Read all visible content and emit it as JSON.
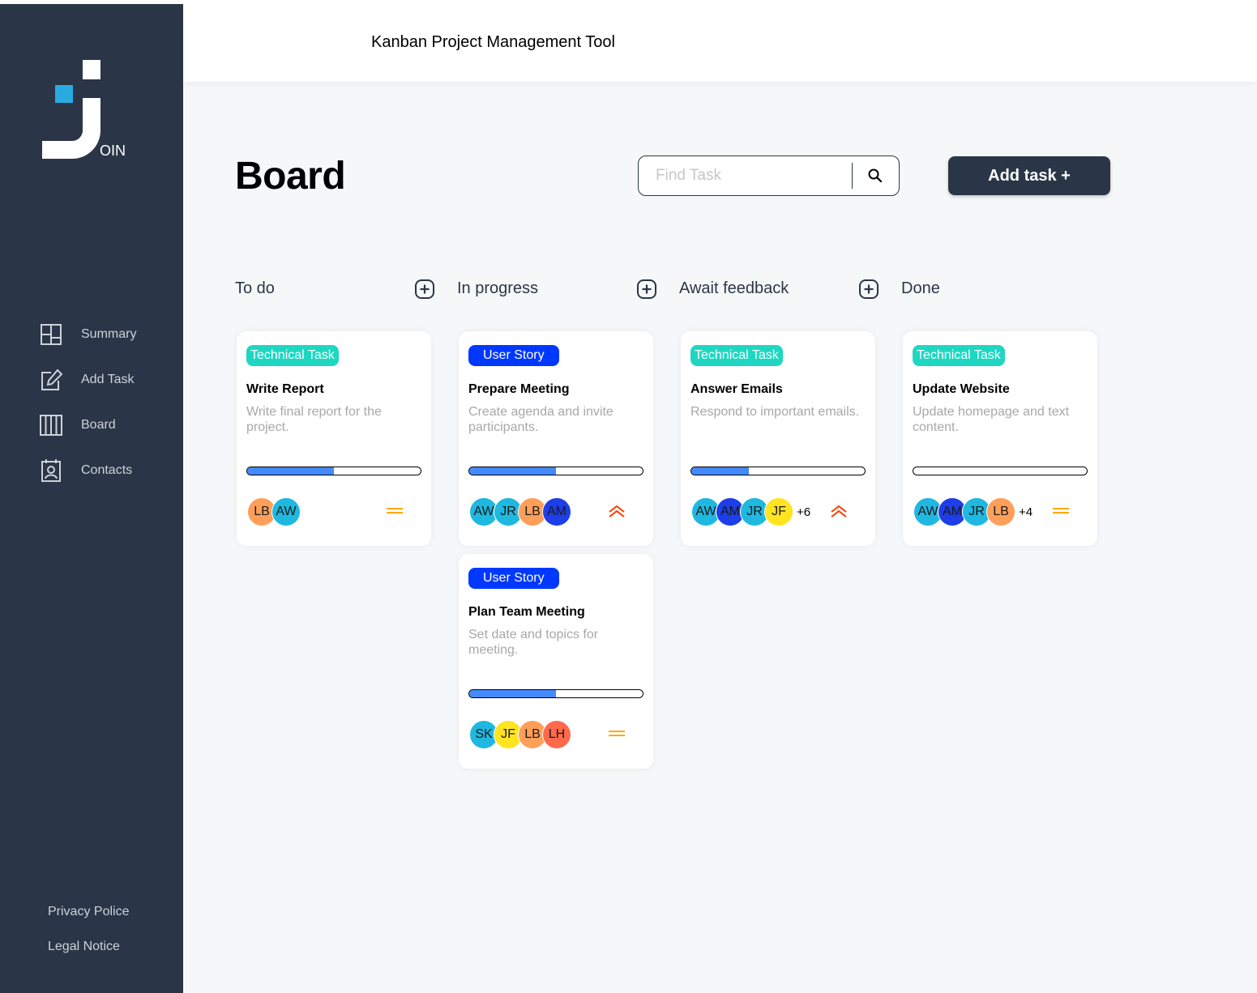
{
  "app": {
    "title": "Kanban Project Management Tool",
    "logo_text": "OIN"
  },
  "sidebar": {
    "items": [
      {
        "label": "Summary",
        "icon": "summary-icon"
      },
      {
        "label": "Add Task",
        "icon": "add-task-icon"
      },
      {
        "label": "Board",
        "icon": "board-icon"
      },
      {
        "label": "Contacts",
        "icon": "contacts-icon"
      }
    ],
    "footer": {
      "privacy": "Privacy Police",
      "legal": "Legal Notice"
    }
  },
  "board": {
    "title": "Board",
    "search_placeholder": "Find Task",
    "add_task_label": "Add task +"
  },
  "colors": {
    "sidebar": "#2a3647",
    "technical_task": "#1fd7c1",
    "user_story": "#0038ff",
    "progress": "#4589ff",
    "priority_urgent": "#ff3d00",
    "priority_medium": "#ffa800"
  },
  "columns": [
    {
      "title": "To do"
    },
    {
      "title": "In progress"
    },
    {
      "title": "Await feedback"
    },
    {
      "title": "Done"
    }
  ],
  "cards": [
    {
      "category": "Technical Task",
      "title": "Write Report",
      "description": "Write final report for the project.",
      "progress": 0.5,
      "assignees": [
        {
          "initials": "LB",
          "color": "#ff9f5a"
        },
        {
          "initials": "AW",
          "color": "#1fb8e0"
        }
      ],
      "more": "",
      "priority": "medium"
    },
    {
      "category": "User Story",
      "title": "Prepare Meeting",
      "description": "Create agenda and invite participants.",
      "progress": 0.5,
      "assignees": [
        {
          "initials": "AW",
          "color": "#1fb8e0"
        },
        {
          "initials": "JR",
          "color": "#1fb8e0"
        },
        {
          "initials": "LB",
          "color": "#ff9f5a"
        },
        {
          "initials": "AM",
          "color": "#1d3ee8"
        }
      ],
      "more": "",
      "priority": "urgent"
    },
    {
      "category": "User Story",
      "title": "Plan Team Meeting",
      "description": "Set date and topics for meeting.",
      "progress": 0.5,
      "assignees": [
        {
          "initials": "SK",
          "color": "#1fb8e0"
        },
        {
          "initials": "JF",
          "color": "#ffe41f"
        },
        {
          "initials": "LB",
          "color": "#ff9f5a"
        },
        {
          "initials": "LH",
          "color": "#ff6a4d"
        }
      ],
      "more": "",
      "priority": "medium"
    },
    {
      "category": "Technical Task",
      "title": "Answer Emails",
      "description": "Respond to important emails.",
      "progress": 0.33,
      "assignees": [
        {
          "initials": "AW",
          "color": "#1fb8e0"
        },
        {
          "initials": "AM",
          "color": "#1d3ee8"
        },
        {
          "initials": "JR",
          "color": "#1fb8e0"
        },
        {
          "initials": "JF",
          "color": "#ffe41f"
        }
      ],
      "more": "+6",
      "priority": "urgent"
    },
    {
      "category": "Technical Task",
      "title": "Update Website",
      "description": "Update homepage and text content.",
      "progress": 0,
      "assignees": [
        {
          "initials": "AW",
          "color": "#1fb8e0"
        },
        {
          "initials": "AM",
          "color": "#1d3ee8"
        },
        {
          "initials": "JR",
          "color": "#1fb8e0"
        },
        {
          "initials": "LB",
          "color": "#ff9f5a"
        }
      ],
      "more": "+4",
      "priority": "medium"
    }
  ]
}
